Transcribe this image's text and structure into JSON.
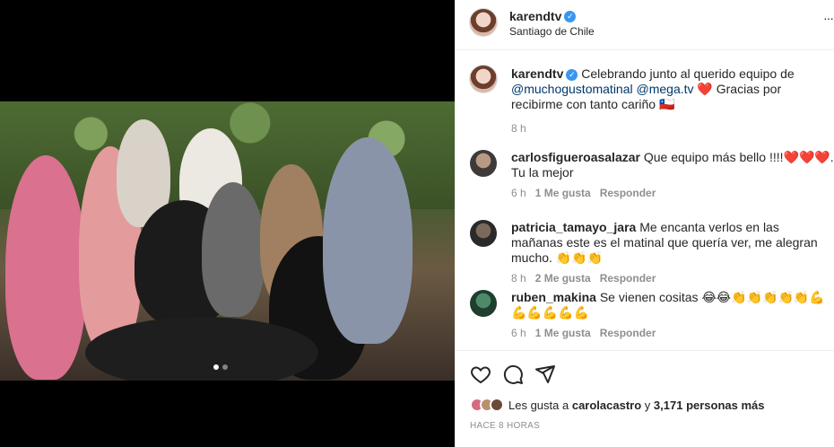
{
  "post": {
    "username": "karendtv",
    "location": "Santiago de Chile",
    "more_label": "···"
  },
  "caption": {
    "username": "karendtv",
    "text_1": "Celebrando junto al querido equipo de",
    "mention_1": "@muchogustomatinal",
    "mention_2": "@mega.tv",
    "text_2": "❤️ Gracias por recibirme con tanto cariño 🇨🇱",
    "time": "8 h"
  },
  "comments": [
    {
      "username": "carlosfigueroasalazar",
      "text": "Que equipo más bello !!!!❤️❤️❤️. Tu la mejor",
      "time": "6 h",
      "likes": "1 Me gusta",
      "reply": "Responder"
    },
    {
      "username": "patricia_tamayo_jara",
      "text": "Me encanta verlos en las mañanas este es el matinal que quería ver, me alegran mucho. 👏👏👏",
      "time": "8 h",
      "likes": "2 Me gusta",
      "reply": "Responder"
    },
    {
      "username": "ruben_makina",
      "text": "Se vienen cositas 😂😂👏👏👏👏👏💪💪💪💪💪💪",
      "time": "6 h",
      "likes": "1 Me gusta",
      "reply": "Responder"
    }
  ],
  "likes": {
    "prefix": "Les gusta a",
    "user": "carolacastro",
    "connector": "y",
    "count": "3,171 personas más"
  },
  "timestamp": "HACE 8 HORAS",
  "icons": {
    "like": "heart-icon",
    "comment": "comment-icon",
    "share": "share-icon",
    "verified": "verified-badge-icon"
  },
  "colors": {
    "verified": "#3897f0",
    "mention": "#00376b",
    "muted": "#8e8e8e"
  }
}
